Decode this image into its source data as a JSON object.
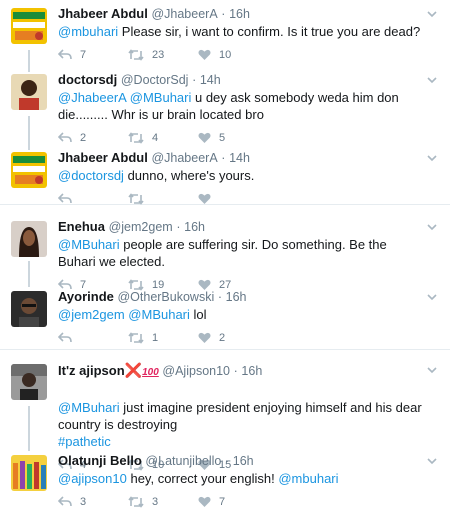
{
  "groups": [
    {
      "tweets": [
        {
          "name": "Jhabeer Abdul",
          "handle": "@JhabeerA",
          "time": "16h",
          "segments": [
            {
              "t": "@mbuhari",
              "m": true
            },
            {
              "t": " Please sir,  i want to confirm.  Is it true you are dead?",
              "m": false
            }
          ],
          "counts": {
            "reply": "7",
            "retweet": "23",
            "like": "10"
          }
        },
        {
          "name": "doctorsdj",
          "handle": "@DoctorSdj",
          "time": "14h",
          "segments": [
            {
              "t": "@JhabeerA",
              "m": true
            },
            {
              "t": " ",
              "m": false
            },
            {
              "t": "@MBuhari",
              "m": true
            },
            {
              "t": " u dey ask somebody weda him don die......... Whr is ur brain located bro",
              "m": false
            }
          ],
          "counts": {
            "reply": "2",
            "retweet": "4",
            "like": "5"
          }
        },
        {
          "name": "Jhabeer Abdul",
          "handle": "@JhabeerA",
          "time": "14h",
          "segments": [
            {
              "t": "@doctorsdj",
              "m": true
            },
            {
              "t": " dunno,  where's yours.",
              "m": false
            }
          ],
          "counts": {
            "reply": "",
            "retweet": "",
            "like": ""
          }
        }
      ]
    },
    {
      "tweets": [
        {
          "name": "Enehua",
          "handle": "@jem2gem",
          "time": "16h",
          "segments": [
            {
              "t": "@MBuhari",
              "m": true
            },
            {
              "t": " people are suffering sir. Do something. Be the Buhari we elected.",
              "m": false
            }
          ],
          "counts": {
            "reply": "7",
            "retweet": "19",
            "like": "27"
          }
        },
        {
          "name": "Ayorinde",
          "handle": "@OtherBukowski",
          "time": "16h",
          "segments": [
            {
              "t": "@jem2gem",
              "m": true
            },
            {
              "t": " ",
              "m": false
            },
            {
              "t": "@MBuhari",
              "m": true
            },
            {
              "t": " lol",
              "m": false
            }
          ],
          "counts": {
            "reply": "",
            "retweet": "1",
            "like": "2"
          }
        }
      ]
    },
    {
      "tweets": [
        {
          "name": "It'z ajipson",
          "name_emoji_x": "❌",
          "name_emoji_100": "100",
          "handle": "@Ajipson10",
          "time": "16h",
          "segments": [
            {
              "t": "@MBuhari",
              "m": true
            },
            {
              "t": " just imagine president enjoying himself and his dear country is destroying",
              "m": false
            },
            {
              "t": "\n",
              "m": false
            },
            {
              "t": "#pathetic",
              "m": true
            }
          ],
          "counts": {
            "reply": "4",
            "retweet": "10",
            "like": "15"
          }
        },
        {
          "name": "Olatunji Bello",
          "handle": "@Latunjibello",
          "time": "16h",
          "segments": [
            {
              "t": "@ajipson10",
              "m": true
            },
            {
              "t": " hey, correct your english! ",
              "m": false
            },
            {
              "t": "@mbuhari",
              "m": true
            }
          ],
          "counts": {
            "reply": "3",
            "retweet": "3",
            "like": "7"
          }
        }
      ]
    }
  ],
  "dot": "·",
  "colors": {
    "mention": "#1b95e0",
    "line": "#ccd6dd",
    "icon": "#aab8c2"
  }
}
